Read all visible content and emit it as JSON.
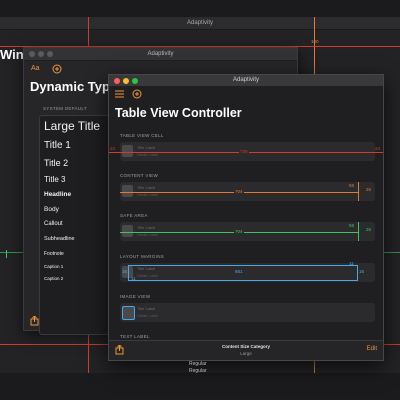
{
  "colors": {
    "accent": "#f0943a",
    "red_guide": "#d23c2b",
    "green_guide": "#3cc65b",
    "blue_guide": "#4aa7e6",
    "orange_guide": "#e07b34"
  },
  "win3": {
    "title": "Adaptivity",
    "large_title_fragment": "Win",
    "marker_top": "100"
  },
  "win2": {
    "title": "Adaptivity",
    "toolbar": {
      "font_icon_label": "Aa",
      "add_icon": "plus-circle-icon"
    },
    "large_title": "Dynamic Type",
    "section_header": "SYSTEM DEFAULT",
    "rows": [
      "Large Title",
      "Title 1",
      "Title 2",
      "Title 3",
      "Headline",
      "Body",
      "Callout",
      "Subheadline",
      "Footnote",
      "Caption 1",
      "Caption 2"
    ]
  },
  "win1": {
    "title": "Adaptivity",
    "large_title": "Table View Controller",
    "cell_title": "Title Label",
    "cell_subtitle": "Detail Label",
    "sections": [
      {
        "header": "TABLE VIEW CELL",
        "measure": "730",
        "left_num": "23",
        "right_num": "23"
      },
      {
        "header": "CONTENT VIEW",
        "measure": "704",
        "left_num": "",
        "right_num": "26",
        "top_num": "58"
      },
      {
        "header": "SAFE AREA",
        "measure": "704",
        "left_num": "",
        "right_num": "26",
        "top_num": "58"
      },
      {
        "header": "LAYOUT MARGINS",
        "measure": "681",
        "left_num": "16",
        "right_num": "16",
        "top_num": "11",
        "bottom_num": "11"
      },
      {
        "header": "IMAGE VIEW",
        "measure": "",
        "left_num": "",
        "right_num": ""
      },
      {
        "header": "TEXT LABEL"
      }
    ],
    "footer": {
      "label": "Content Size Category",
      "value": "Large",
      "edit": "Edit"
    }
  },
  "stray_text": [
    "Regular",
    "Regular"
  ]
}
